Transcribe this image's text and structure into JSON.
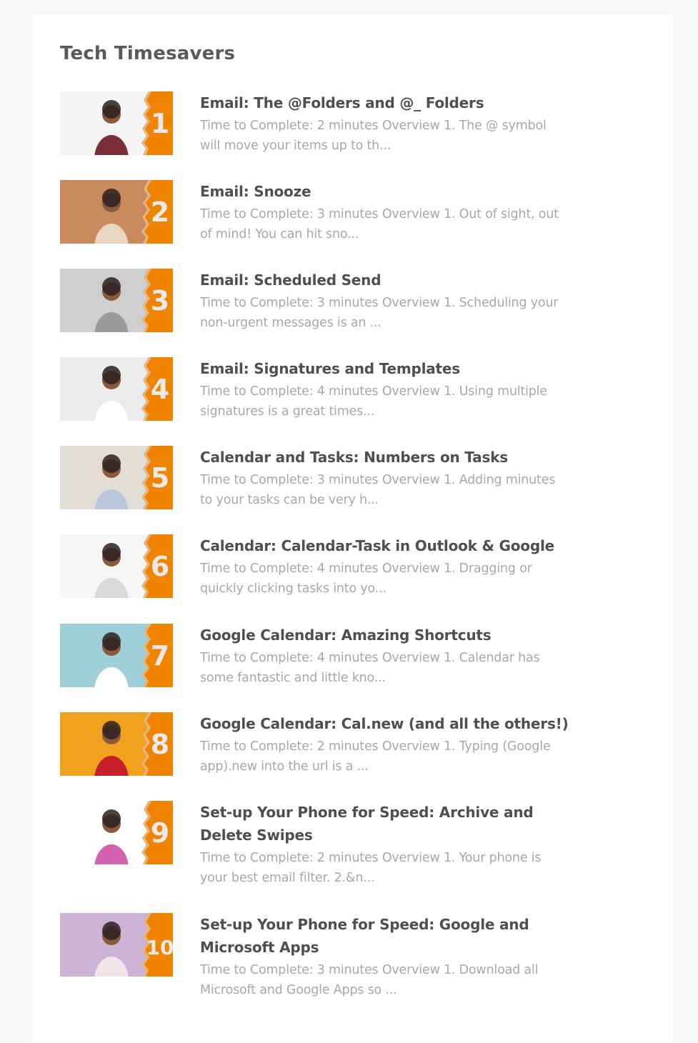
{
  "page": {
    "title": "Tech Timesavers"
  },
  "colors": {
    "accent": "#f08300",
    "title_text": "#4f4f4f",
    "desc_text": "#a8a8a8"
  },
  "items": [
    {
      "number": "1",
      "title": "Email: The @Folders and @_ Folders",
      "desc": "Time to Complete: 2 minutes Overview 1. The @ symbol will move your items up to th...",
      "thumb_bg": "#f4f4f4",
      "person": "#7b2d3a"
    },
    {
      "number": "2",
      "title": "Email: Snooze",
      "desc": "Time to Complete: 3 minutes Overview 1. Out of sight, out of mind! You can hit sno...",
      "thumb_bg": "#c98a5e",
      "person": "#e8d6c2"
    },
    {
      "number": "3",
      "title": "Email: Scheduled Send",
      "desc": "Time to Complete: 3 minutes Overview 1. Scheduling your non-urgent messages is an ...",
      "thumb_bg": "#cfcfcf",
      "person": "#9a9a9a"
    },
    {
      "number": "4",
      "title": "Email: Signatures and Templates",
      "desc": "Time to Complete: 4 minutes Overview 1. Using multiple signatures is a great times...",
      "thumb_bg": "#ebebeb",
      "person": "#ffffff"
    },
    {
      "number": "5",
      "title": "Calendar and Tasks: Numbers on Tasks",
      "desc": "Time to Complete: 3 minutes Overview 1. Adding minutes to your tasks can be very h...",
      "thumb_bg": "#e2ddd5",
      "person": "#b9c7dc"
    },
    {
      "number": "6",
      "title": "Calendar: Calendar-Task in Outlook & Google",
      "desc": "Time to Complete: 4 minutes Overview 1. Dragging or quickly clicking tasks into yo...",
      "thumb_bg": "#f6f6f6",
      "person": "#d9d9d9"
    },
    {
      "number": "7",
      "title": "Google Calendar: Amazing Shortcuts",
      "desc": "Time to Complete: 4 minutes Overview 1. Calendar has some fantastic and little kno...",
      "thumb_bg": "#9fd0da",
      "person": "#ffffff"
    },
    {
      "number": "8",
      "title": "Google Calendar: Cal.new (and all the others!)",
      "desc": "Time to Complete: 2 minutes Overview 1. Typing (Google app).new into the url is a ...",
      "thumb_bg": "#f0a21e",
      "person": "#c8202b"
    },
    {
      "number": "9",
      "title": "Set-up Your Phone for Speed: Archive and Delete Swipes",
      "desc": "Time to Complete: 2 minutes Overview 1. Your phone is your best email filter. 2.&n...",
      "thumb_bg": "#ffffff",
      "person": "#d462b0"
    },
    {
      "number": "10",
      "title": "Set-up Your Phone for Speed: Google and Microsoft Apps",
      "desc": "Time to Complete: 3 minutes Overview 1. Download all Microsoft and Google Apps so ...",
      "thumb_bg": "#cdb4d6",
      "person": "#f1e5ea"
    }
  ]
}
